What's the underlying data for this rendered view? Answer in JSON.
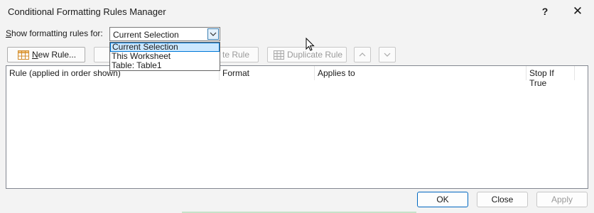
{
  "window": {
    "title": "Conditional Formatting Rules Manager",
    "help_glyph": "?",
    "close_glyph": "✕"
  },
  "scope": {
    "label_prefix": "S",
    "label_rest": "how formatting rules for:",
    "selected": "Current Selection",
    "options": [
      "Current Selection",
      "This Worksheet",
      "Table: Table1"
    ]
  },
  "toolbar": {
    "new_rule_label_underlined": "N",
    "new_rule_label_rest": "ew Rule...",
    "delete_rule_label": "te Rule",
    "duplicate_rule_label": "Duplicate Rule"
  },
  "table": {
    "columns": [
      "Rule (applied in order shown)",
      "Format",
      "Applies to",
      "Stop If True"
    ]
  },
  "footer": {
    "ok_label": "OK",
    "close_label": "Close",
    "apply_label": "Apply"
  },
  "icons": {
    "new_rule": "grid-table-icon",
    "duplicate_rule": "grid-table-icon",
    "move_up": "chevron-up-icon",
    "move_down": "chevron-down-icon",
    "dropdown": "chevron-down-icon",
    "cursor": "mouse-pointer-icon"
  },
  "colors": {
    "accent": "#0078d7",
    "selection_bg": "#cce8ff",
    "disabled_text": "#9a9a9a"
  }
}
